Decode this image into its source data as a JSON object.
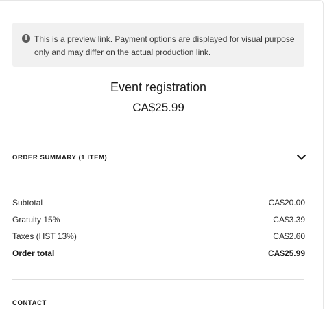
{
  "notice": {
    "icon": "info-icon",
    "text": "This is a preview link. Payment options are displayed for visual purpose only and may differ on the actual production link."
  },
  "event": {
    "title": "Event registration",
    "price": "CA$25.99"
  },
  "order_summary": {
    "label": "ORDER SUMMARY (1 ITEM)",
    "toggle_icon": "chevron-down-icon",
    "expanded": false
  },
  "totals": [
    {
      "label": "Subtotal",
      "amount": "CA$20.00"
    },
    {
      "label": "Gratuity 15%",
      "amount": "CA$3.39"
    },
    {
      "label": "Taxes (HST 13%)",
      "amount": "CA$2.60"
    },
    {
      "label": "Order total",
      "amount": "CA$25.99"
    }
  ],
  "contact": {
    "label": "CONTACT"
  }
}
